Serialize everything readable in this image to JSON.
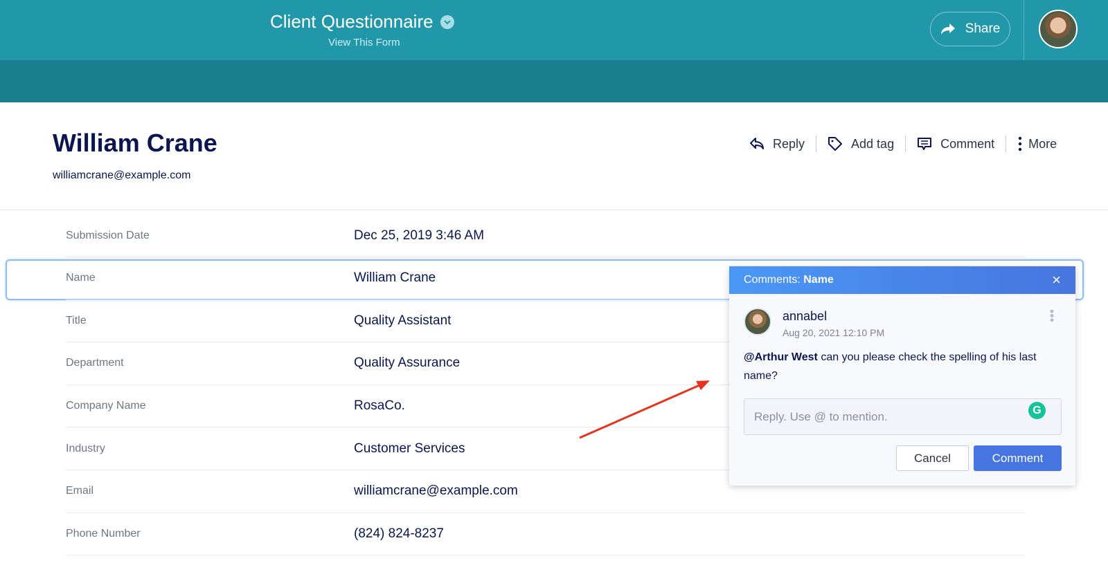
{
  "header": {
    "title": "Client Questionnaire",
    "subtitle": "View This Form",
    "share_label": "Share"
  },
  "submission": {
    "name": "William Crane",
    "email": "williamcrane@example.com"
  },
  "actions": [
    {
      "label": "Reply",
      "icon": "reply-icon"
    },
    {
      "label": "Add tag",
      "icon": "tag-icon"
    },
    {
      "label": "Comment",
      "icon": "comment-icon"
    },
    {
      "label": "More",
      "icon": "more-vertical-icon"
    }
  ],
  "fields": [
    {
      "label": "Submission Date",
      "value": "Dec 25, 2019 3:46 AM"
    },
    {
      "label": "Name",
      "value": "William Crane"
    },
    {
      "label": "Title",
      "value": "Quality Assistant"
    },
    {
      "label": "Department",
      "value": "Quality Assurance"
    },
    {
      "label": "Company Name",
      "value": "RosaCo."
    },
    {
      "label": "Industry",
      "value": "Customer Services"
    },
    {
      "label": "Email",
      "value": "williamcrane@example.com"
    },
    {
      "label": "Phone Number",
      "value": "(824) 824-8237"
    }
  ],
  "comments": {
    "prefix": "Comments:",
    "field": "Name",
    "author": "annabel",
    "date": "Aug 20, 2021 12:10 PM",
    "mention": "@Arthur West",
    "text": " can you please check the spelling of his last name?",
    "reply_placeholder": "Reply. Use @ to mention.",
    "cancel_label": "Cancel",
    "comment_label": "Comment"
  },
  "colors": {
    "header": "#2198aa",
    "band": "#1a7f8e",
    "accent": "#4674e0",
    "arrow": "#e8321e"
  }
}
